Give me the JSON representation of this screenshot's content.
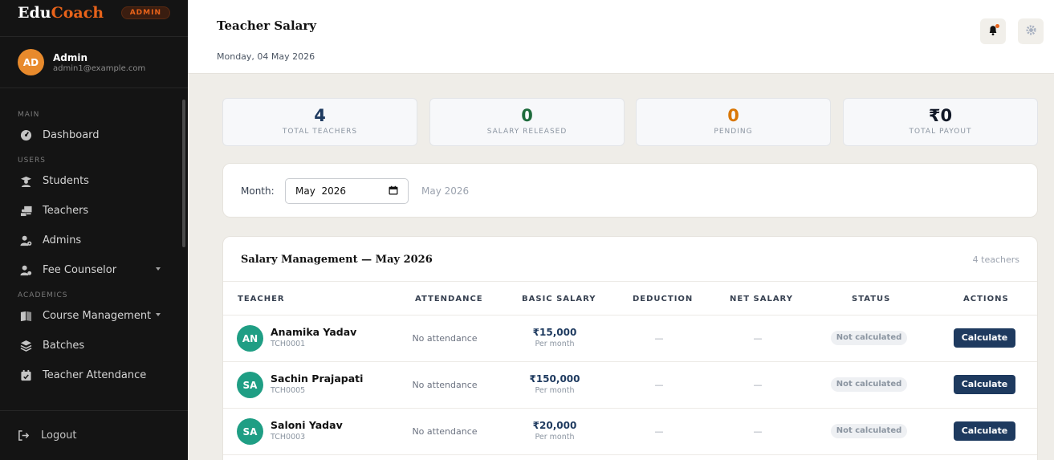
{
  "brand": {
    "part1": "Edu",
    "part2": "Coach",
    "badge": "ADMIN"
  },
  "user": {
    "initials": "AD",
    "name": "Admin",
    "email": "admin1@example.com"
  },
  "nav": {
    "sections": [
      {
        "label": "MAIN",
        "items": [
          {
            "label": "Dashboard",
            "icon": "dashboard-icon"
          }
        ]
      },
      {
        "label": "USERS",
        "items": [
          {
            "label": "Students",
            "icon": "student-icon"
          },
          {
            "label": "Teachers",
            "icon": "teacher-icon"
          },
          {
            "label": "Admins",
            "icon": "admin-icon"
          },
          {
            "label": "Fee Counselor",
            "icon": "counselor-icon",
            "has_caret": true
          }
        ]
      },
      {
        "label": "ACADEMICS",
        "items": [
          {
            "label": "Course Management",
            "icon": "book-icon",
            "has_caret": true
          },
          {
            "label": "Batches",
            "icon": "layers-icon"
          },
          {
            "label": "Teacher Attendance",
            "icon": "calendar-check-icon"
          }
        ]
      }
    ],
    "logout": "Logout"
  },
  "header": {
    "title": "Teacher Salary",
    "date": "Monday, 04 May 2026"
  },
  "stats": [
    {
      "value": "4",
      "label": "TOTAL TEACHERS",
      "color": "#1e3a5f"
    },
    {
      "value": "0",
      "label": "SALARY RELEASED",
      "color": "#1e6b3c"
    },
    {
      "value": "0",
      "label": "PENDING",
      "color": "#d97706"
    },
    {
      "value": "₹0",
      "label": "TOTAL PAYOUT",
      "color": "#111827"
    }
  ],
  "filter": {
    "label": "Month:",
    "value": "May  2026",
    "hint": "May 2026"
  },
  "table": {
    "title": "Salary Management — May 2026",
    "count": "4 teachers",
    "columns": [
      "TEACHER",
      "ATTENDANCE",
      "BASIC SALARY",
      "DEDUCTION",
      "NET SALARY",
      "STATUS",
      "ACTIONS"
    ],
    "rows": [
      {
        "initials": "AN",
        "name": "Anamika Yadav",
        "id": "TCH0001",
        "attendance": "No attendance",
        "salary": "₹15,000",
        "salary_sub": "Per month",
        "deduction": "—",
        "net": "—",
        "status": "Not calculated",
        "action": "Calculate"
      },
      {
        "initials": "SA",
        "name": "Sachin Prajapati",
        "id": "TCH0005",
        "attendance": "No attendance",
        "salary": "₹150,000",
        "salary_sub": "Per month",
        "deduction": "—",
        "net": "—",
        "status": "Not calculated",
        "action": "Calculate"
      },
      {
        "initials": "SA",
        "name": "Saloni Yadav",
        "id": "TCH0003",
        "attendance": "No attendance",
        "salary": "₹20,000",
        "salary_sub": "Per month",
        "deduction": "—",
        "net": "—",
        "status": "Not calculated",
        "action": "Calculate"
      }
    ]
  },
  "colors": {
    "accent": "#e8631a",
    "primary": "#1e3a5f",
    "avatar_teal": "#1f9e84",
    "sidebar_bg": "#141414"
  }
}
